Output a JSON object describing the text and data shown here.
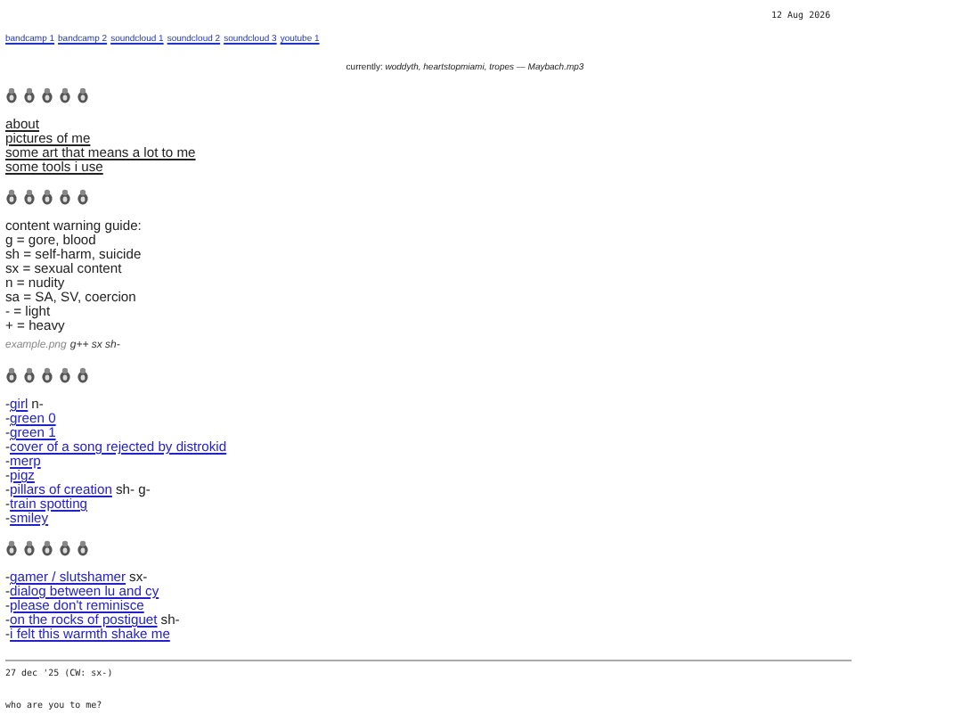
{
  "date": "12 Aug 2026",
  "music_links": [
    "bandcamp 1",
    "bandcamp 2",
    "soundcloud 1",
    "soundcloud 2",
    "soundcloud 3",
    "youtube 1"
  ],
  "now_playing": {
    "label": "currently:",
    "text": "woddyth, heartstopmiami, tropes — Maybach.mp3"
  },
  "blocks": [
    {
      "kind": "icons"
    },
    {
      "kind": "nav",
      "links": [
        "about",
        "pictures of me",
        "some art that means a lot to me",
        "some tools i use"
      ]
    },
    {
      "kind": "icons"
    },
    {
      "kind": "text",
      "lines": [
        "content warning guide:",
        "g = gore, blood",
        "sh = self-harm, suicide",
        "sx = sexual content",
        "n = nudity",
        "sa = SA, SV, coercion",
        "- = light",
        "+ = heavy"
      ]
    },
    {
      "kind": "example",
      "file": "example.png",
      "tags": "g++ sx sh-"
    },
    {
      "kind": "icons"
    },
    {
      "kind": "posts",
      "items": [
        {
          "prefix": "-",
          "title": "girl",
          "tags": "n-"
        },
        {
          "prefix": "-",
          "title": "green 0"
        },
        {
          "prefix": "-",
          "title": "green 1"
        },
        {
          "prefix": "-",
          "title": "cover of a song rejected by distrokid"
        },
        {
          "prefix": "-",
          "title": "merp"
        },
        {
          "prefix": "-",
          "title": "pigz"
        },
        {
          "prefix": "-",
          "title": "pillars of creation",
          "tags": "sh- g-"
        },
        {
          "prefix": "-",
          "title": "train spotting"
        },
        {
          "prefix": "-",
          "title": "smiley"
        }
      ]
    },
    {
      "kind": "icons"
    },
    {
      "kind": "posts",
      "items": [
        {
          "prefix": "-",
          "title": "gamer / slutshamer",
          "tags": "sx-"
        },
        {
          "prefix": "-",
          "title": "dialog between lu and cy"
        },
        {
          "prefix": "-",
          "title": "please don't reminisce"
        },
        {
          "prefix": "-",
          "title": "on the rocks of postiguet",
          "tags": "sh-"
        },
        {
          "prefix": "-",
          "title": "i felt this warmth shake me"
        }
      ]
    }
  ],
  "entry": {
    "date": "27 dec '25 (CW: sx-)",
    "text": "who are you to me?"
  }
}
